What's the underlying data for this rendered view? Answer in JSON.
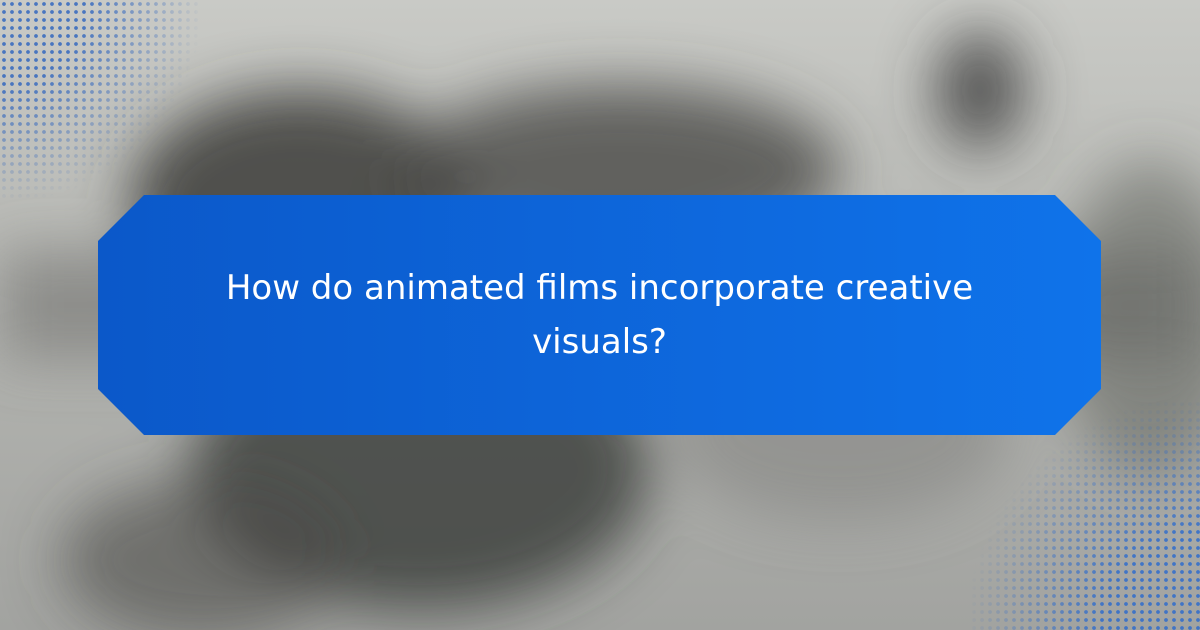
{
  "headline": "How do animated films incorporate creative visuals?",
  "colors": {
    "banner_start": "#0b58c9",
    "banner_end": "#0f73ea",
    "headline_text": "#ffffff",
    "dot_pattern": "#1e5abe"
  }
}
